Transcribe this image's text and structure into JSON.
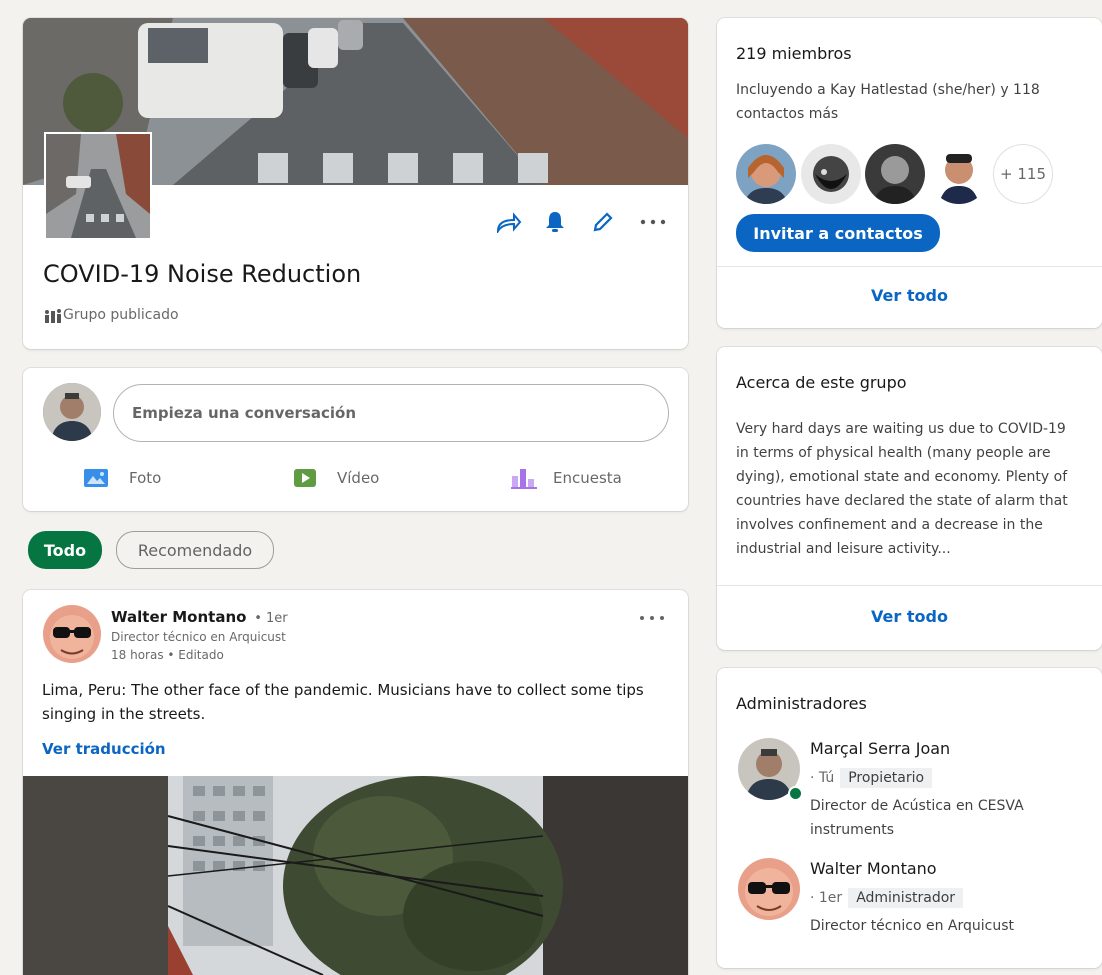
{
  "group": {
    "name": "COVID-19 Noise Reduction",
    "type_label": "Grupo publicado"
  },
  "composer": {
    "placeholder": "Empieza una conversación",
    "actions": [
      {
        "label": "Foto",
        "icon": "photo-icon",
        "color": "#378fe9"
      },
      {
        "label": "Vídeo",
        "icon": "video-icon",
        "color": "#5f9b41"
      },
      {
        "label": "Encuesta",
        "icon": "poll-icon",
        "color": "#a872e8"
      }
    ]
  },
  "filters": {
    "active": "Todo",
    "other": "Recomendado"
  },
  "post": {
    "author": "Walter Montano",
    "degree": "• 1er",
    "headline": "Director técnico en Arquicust",
    "meta": "18 horas • Editado",
    "text": "Lima, Peru: The other face of the pandemic. Musicians have to collect some tips singing in the streets.",
    "translate_label": "Ver traducción"
  },
  "members": {
    "count_label": "219 miembros",
    "including_text": "Incluyendo a Kay Hatlestad (she/her) y 118 contactos más",
    "more_count": "+ 115",
    "invite_label": "Invitar a contactos",
    "see_all": "Ver todo"
  },
  "about": {
    "title": "Acerca de este grupo",
    "description": "Very hard days are waiting us due to COVID-19 in terms of physical health (many people are dying), emotional state and economy. Plenty of countries have declared the state of alarm that involves confinement and a decrease in the industrial and leisure activity...",
    "see_all": "Ver todo"
  },
  "admins": {
    "title": "Administradores",
    "list": [
      {
        "name": "Marçal Serra Joan",
        "degree": "· Tú",
        "role": "Propietario",
        "headline": "Director de Acústica en CESVA instruments"
      },
      {
        "name": "Walter Montano",
        "degree": "· 1er",
        "role": "Administrador",
        "headline": "Director técnico en Arquicust"
      }
    ]
  },
  "colors": {
    "brand_blue": "#0a66c2",
    "filter_green": "#057642",
    "online_green": "#057642"
  }
}
